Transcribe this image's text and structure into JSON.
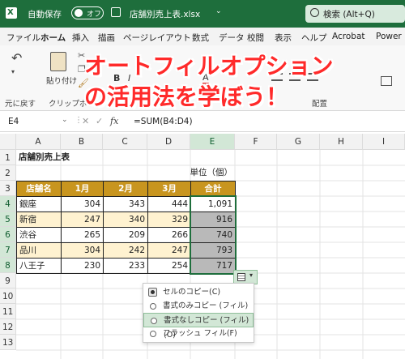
{
  "titlebar": {
    "autosave_label": "自動保存",
    "autosave_state": "オフ",
    "filename": "店舗別売上表.xlsx",
    "search_placeholder": "検索 (Alt+Q)"
  },
  "ribbon": {
    "tabs": [
      "ファイル",
      "ホーム",
      "挿入",
      "描画",
      "ページレイアウト",
      "数式",
      "データ",
      "校閲",
      "表示",
      "ヘルプ",
      "Acrobat",
      "Power"
    ],
    "active_tab_index": 1,
    "paste_label": "貼り付け",
    "undo_group": "元に戻す",
    "clipboard_group": "クリップボード",
    "align_group": "配置",
    "bold": "B",
    "italic": "I"
  },
  "overlay_title": {
    "line1": "オートフィルオプション",
    "line2": "の活用法を学ぼう！"
  },
  "formula_bar": {
    "name_box": "E4",
    "fx": "fx",
    "formula": "=SUM(B4:D4)"
  },
  "sheet": {
    "columns": [
      "A",
      "B",
      "C",
      "D",
      "E",
      "F",
      "G",
      "H",
      "I"
    ],
    "selected_column": "E",
    "rows": [
      "1",
      "2",
      "3",
      "4",
      "5",
      "6",
      "7",
      "8",
      "9",
      "10",
      "11",
      "12",
      "13"
    ],
    "title": "店舗別売上表",
    "unit": "単位（個）",
    "table_headers": [
      "店舗名",
      "1月",
      "2月",
      "3月",
      "合計"
    ],
    "table_rows": [
      {
        "name": "銀座",
        "m1": "304",
        "m2": "343",
        "m3": "444",
        "total": "1,091"
      },
      {
        "name": "新宿",
        "m1": "247",
        "m2": "340",
        "m3": "329",
        "total": "916"
      },
      {
        "name": "渋谷",
        "m1": "265",
        "m2": "209",
        "m3": "266",
        "total": "740"
      },
      {
        "name": "品川",
        "m1": "304",
        "m2": "242",
        "m3": "247",
        "total": "793"
      },
      {
        "name": "八王子",
        "m1": "230",
        "m2": "233",
        "m3": "254",
        "total": "717"
      }
    ]
  },
  "autofill_menu": {
    "items": [
      "セルのコピー(C)",
      "書式のみコピー (フィル)(F)",
      "書式なしコピー (フィル)(O)",
      "フラッシュ フィル(F)"
    ],
    "selected_index": 2,
    "checked_index": 0
  },
  "colors": {
    "excel_green": "#1e6e3c",
    "header_gold": "#c8951f",
    "alt_row": "#fff2d0",
    "overlay_red": "#ff2a2a"
  }
}
